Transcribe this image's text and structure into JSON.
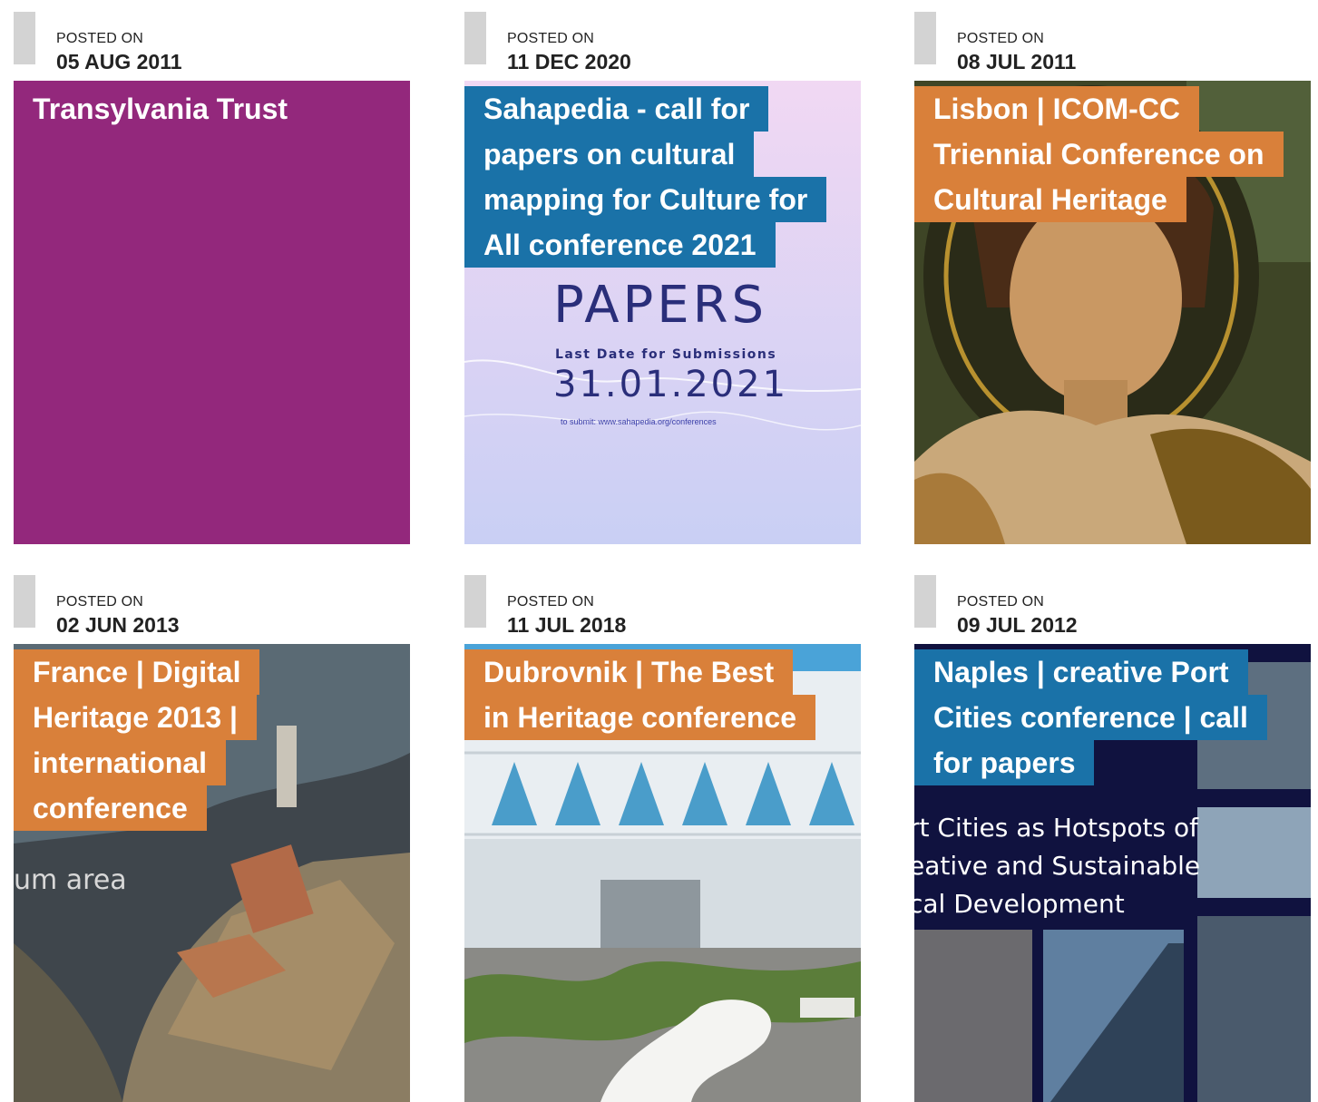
{
  "posted_label": "POSTED ON",
  "colors": {
    "purple": "#93287c",
    "blue": "#1a72a8",
    "orange": "#d9803a",
    "date_bar": "#d3d3d3"
  },
  "cards": [
    {
      "date": "05 AUG 2011",
      "title_lines": [
        "Transylvania Trust"
      ],
      "title_color": "purple"
    },
    {
      "date": "11 DEC 2020",
      "title_lines": [
        "Sahapedia - call for",
        "papers on cultural",
        "mapping for Culture for",
        "All conference 2021"
      ],
      "title_color": "blue",
      "image_text": {
        "papers": "PAPERS",
        "last_date": "Last Date for Submissions",
        "deadline": "31.01.2021",
        "submit": "to submit: www.sahapedia.org/conferences"
      }
    },
    {
      "date": "08 JUL 2011",
      "title_lines": [
        "Lisbon | ICOM-CC",
        "Triennial Conference on",
        "Cultural Heritage"
      ],
      "title_color": "orange"
    },
    {
      "date": "02 JUN 2013",
      "title_lines": [
        "France | Digital",
        "Heritage 2013 |",
        "international",
        "conference"
      ],
      "title_color": "orange",
      "image_text": {
        "caption": "um area"
      }
    },
    {
      "date": "11 JUL 2018",
      "title_lines": [
        "Dubrovnik | The Best",
        "in Heritage conference"
      ],
      "title_color": "orange"
    },
    {
      "date": "09 JUL 2012",
      "title_lines": [
        "Naples | creative Port",
        "Cities conference | call",
        "for papers"
      ],
      "title_color": "blue",
      "image_text": {
        "line1": "rt Cities as Hotspots of",
        "line2": "eative and Sustainable",
        "line3": "cal Development"
      }
    }
  ]
}
